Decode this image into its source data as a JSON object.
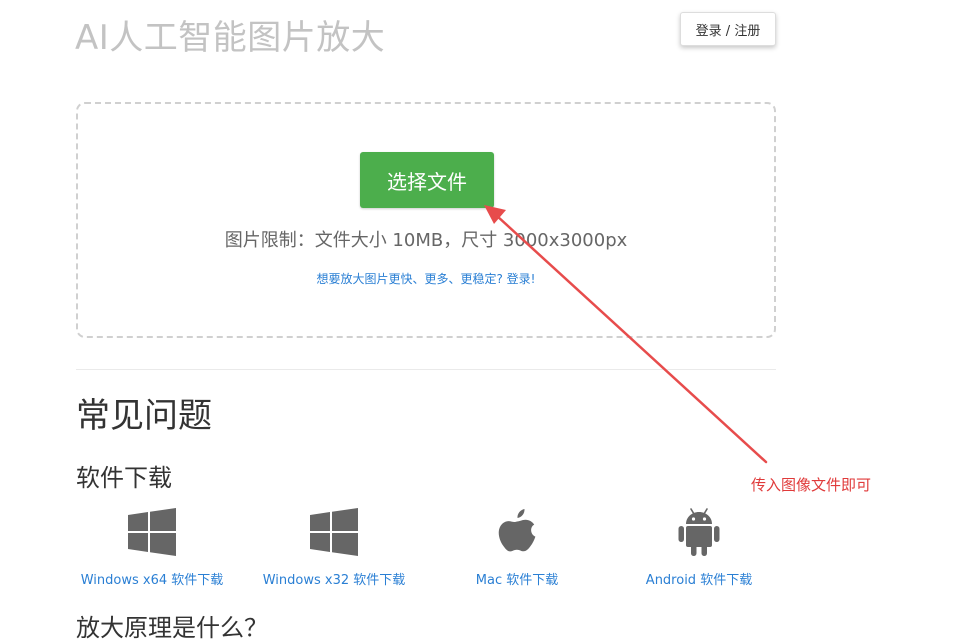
{
  "header": {
    "title": "AI人工智能图片放大",
    "login_label": "登录 / 注册"
  },
  "upload": {
    "choose_button": "选择文件",
    "limit_text": "图片限制：文件大小 10MB，尺寸 3000x3000px",
    "vip_link": "想要放大图片更快、更多、更稳定? 登录!"
  },
  "faq": {
    "heading": "常见问题",
    "download_heading": "软件下载",
    "downloads": [
      {
        "label": "Windows x64 软件下载",
        "icon": "windows-icon"
      },
      {
        "label": "Windows x32 软件下载",
        "icon": "windows-icon"
      },
      {
        "label": "Mac 软件下载",
        "icon": "apple-icon"
      },
      {
        "label": "Android 软件下载",
        "icon": "android-icon"
      }
    ],
    "principle_heading": "放大原理是什么？"
  },
  "annotation": {
    "text": "传入图像文件即可",
    "color": "#e03a3a"
  },
  "colors": {
    "primary_green": "#4cae4c",
    "link_blue": "#2a7fd4",
    "icon_gray": "#666666"
  }
}
